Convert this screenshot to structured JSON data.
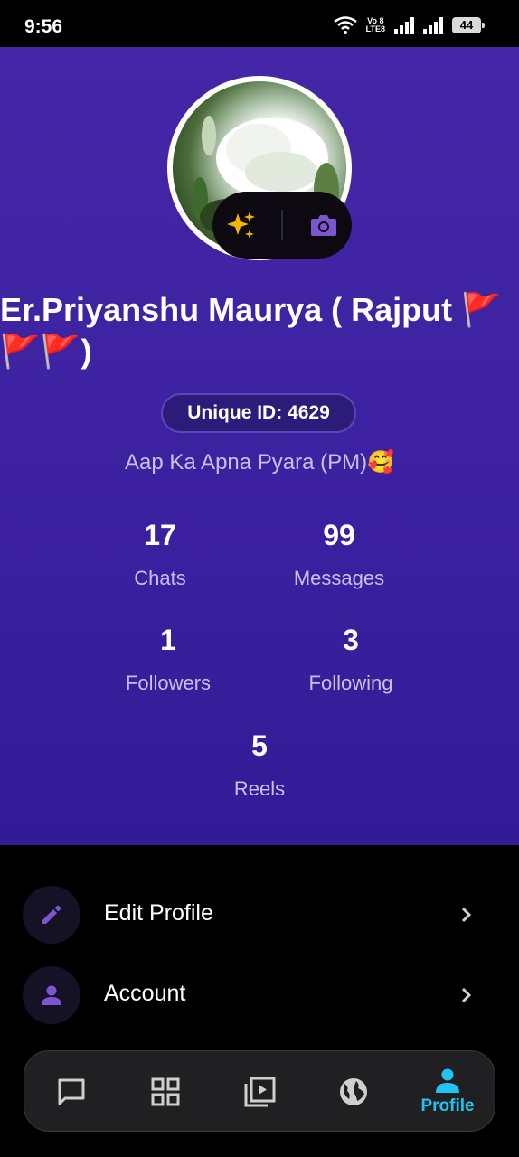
{
  "status_bar": {
    "time": "9:56",
    "volte_top": "Vo 8",
    "volte_bottom": "LTE8",
    "battery": "44"
  },
  "profile": {
    "name": "Er.Priyanshu Maurya ( Rajput 🚩🚩🚩)",
    "unique_id": "Unique ID: 4629",
    "bio": "Aap Ka Apna Pyara (PM)🥰"
  },
  "stats": [
    {
      "value": "17",
      "label": "Chats"
    },
    {
      "value": "99",
      "label": "Messages"
    },
    {
      "value": "1",
      "label": "Followers"
    },
    {
      "value": "3",
      "label": "Following"
    },
    {
      "value": "5",
      "label": "Reels"
    }
  ],
  "menu": [
    {
      "label": "Edit Profile",
      "icon": "pencil-icon"
    },
    {
      "label": "Account",
      "icon": "person-icon"
    }
  ],
  "bottom_nav": {
    "items": [
      "chat-icon",
      "grid-icon",
      "reels-icon",
      "globe-icon",
      "person-icon"
    ],
    "active_label": "Profile"
  },
  "colors": {
    "accent": "#22c3f0",
    "header_top": "#4427a6",
    "icon_purple": "#7a57d1",
    "sparkle": "#f5b800"
  }
}
